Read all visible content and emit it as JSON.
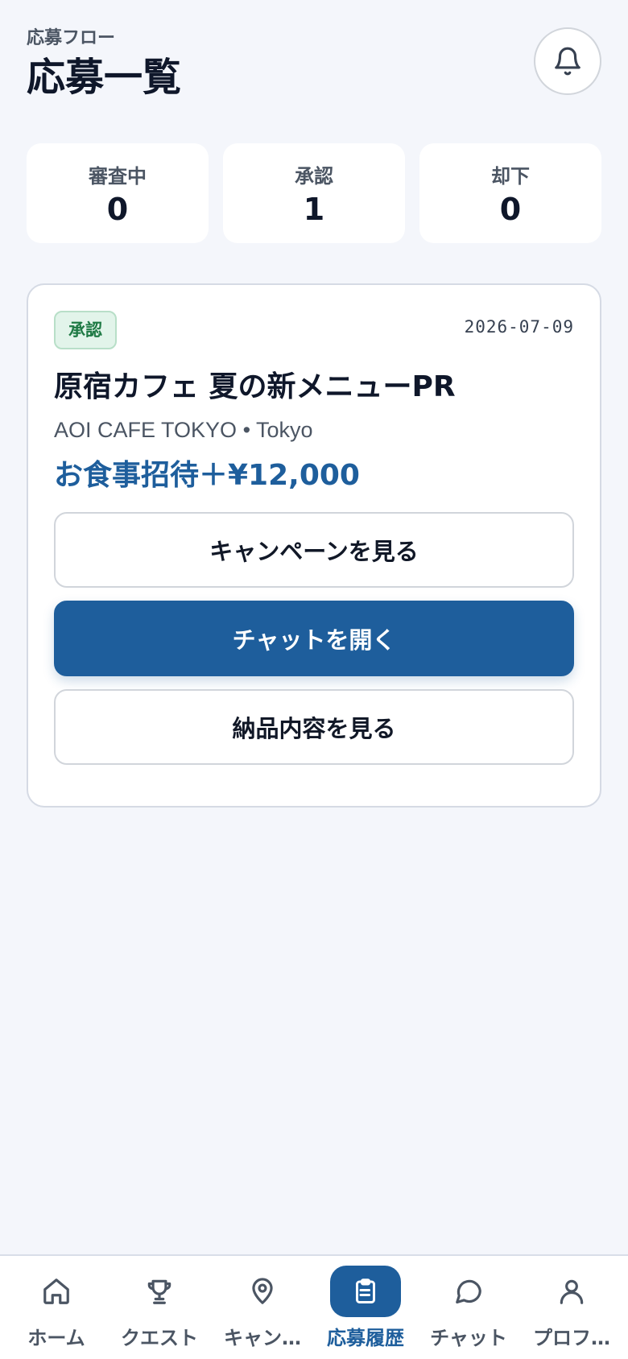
{
  "header": {
    "subtitle": "応募フロー",
    "title": "応募一覧",
    "notification_icon": "bell-icon"
  },
  "stats": [
    {
      "label": "審査中",
      "value": "0"
    },
    {
      "label": "承認",
      "value": "1"
    },
    {
      "label": "却下",
      "value": "0"
    }
  ],
  "application": {
    "status": "承認",
    "date": "2026-07-09",
    "title": "原宿カフェ 夏の新メニューPR",
    "subtitle": "AOI CAFE TOKYO • Tokyo",
    "reward": "お食事招待＋¥12,000",
    "buttons": {
      "view_campaign": "キャンペーンを見る",
      "open_chat": "チャットを開く",
      "view_delivery": "納品内容を見る"
    }
  },
  "bottom_nav": {
    "items": [
      {
        "label": "ホーム",
        "icon": "home-icon"
      },
      {
        "label": "クエスト",
        "icon": "trophy-icon"
      },
      {
        "label": "キャン…",
        "icon": "map-pin-icon"
      },
      {
        "label": "応募履歴",
        "icon": "clipboard-icon",
        "active": true
      },
      {
        "label": "チャット",
        "icon": "chat-bubble-icon"
      },
      {
        "label": "プロフ…",
        "icon": "user-icon"
      }
    ]
  },
  "colors": {
    "primary": "#1e5e9c",
    "background": "#f4f6fb",
    "badge_bg": "#e2f4ea",
    "badge_text": "#1f7a45"
  }
}
